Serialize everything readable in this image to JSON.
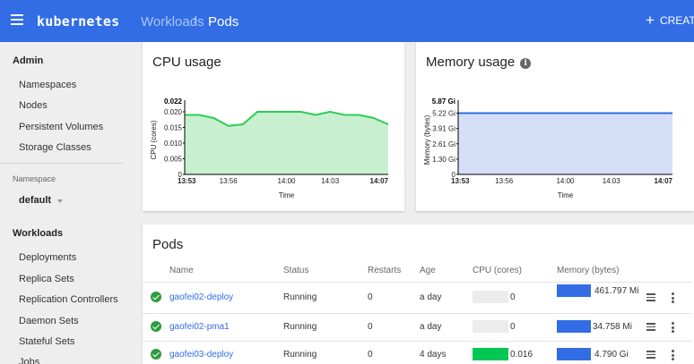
{
  "topbar": {
    "brand": "kubernetes",
    "breadcrumb": [
      "Workloads",
      "Pods"
    ],
    "breadcrumb_sep": "›",
    "create_label": "CREATE",
    "color": "#326de6"
  },
  "sidebar": {
    "admin_title": "Admin",
    "admin_items": [
      "Namespaces",
      "Nodes",
      "Persistent Volumes",
      "Storage Classes"
    ],
    "namespace_label": "Namespace",
    "namespace_value": "default",
    "workloads_title": "Workloads",
    "workload_items": [
      "Deployments",
      "Replica Sets",
      "Replication Controllers",
      "Daemon Sets",
      "Stateful Sets",
      "Jobs"
    ]
  },
  "cpu_card": {
    "title": "CPU usage"
  },
  "memory_card": {
    "title": "Memory usage",
    "info_icon": "i"
  },
  "pods_card": {
    "title": "Pods",
    "columns": [
      "Name",
      "Status",
      "Restarts",
      "Age",
      "CPU (cores)",
      "Memory (bytes)"
    ],
    "rows": [
      {
        "name": "gaofei02-deploy",
        "status": "Running",
        "restarts": "0",
        "age": "a day",
        "cpu": "0",
        "cpu_fraction": 0.0,
        "memory": "461.797 Mi",
        "memory_fraction": 0.95
      },
      {
        "name": "gaofei02-pma1",
        "status": "Running",
        "restarts": "0",
        "age": "a day",
        "cpu": "0",
        "cpu_fraction": 0.0,
        "memory": "34.758 Mi",
        "memory_fraction": 0.95
      },
      {
        "name": "gaofei03-deploy",
        "status": "Running",
        "restarts": "0",
        "age": "4 days",
        "cpu": "0.016",
        "cpu_fraction": 0.6,
        "memory": "4.790 Gi",
        "memory_fraction": 0.95
      }
    ]
  },
  "chart_data": [
    {
      "type": "area",
      "ylabel": "CPU (cores)",
      "xlabel": "Time",
      "x_ticks": [
        "13:53",
        "13:56",
        "14:00",
        "14:03",
        "14:07"
      ],
      "y_ticks": [
        "0",
        "0.005",
        "0.010",
        "0.015",
        "0.020"
      ],
      "y_max_label": "0.022",
      "ylim": [
        0,
        0.022
      ],
      "x_minutes": [
        0,
        1,
        2,
        3,
        4,
        5,
        6,
        7,
        8,
        9,
        10,
        11,
        12,
        13,
        14
      ],
      "series": [
        {
          "values": [
            0.019,
            0.019,
            0.018,
            0.0155,
            0.016,
            0.02,
            0.02,
            0.02,
            0.02,
            0.019,
            0.02,
            0.019,
            0.019,
            0.018,
            0.016
          ]
        }
      ],
      "color": "#2ecc57",
      "fill": "#c8f0d0"
    },
    {
      "type": "area",
      "ylabel": "Memory (bytes)",
      "xlabel": "Time",
      "x_ticks": [
        "13:53",
        "13:56",
        "14:00",
        "14:03",
        "14:07"
      ],
      "y_ticks": [
        "0",
        "1.30 Gi",
        "2.61 Gi",
        "3.91 Gi",
        "5.22 Gi"
      ],
      "y_max_label": "5.87 Gi",
      "ylim": [
        0,
        5.87
      ],
      "x_minutes": [
        0,
        14
      ],
      "series": [
        {
          "values": [
            5.22,
            5.22
          ]
        }
      ],
      "color": "#326de6",
      "fill": "#d5dff8"
    }
  ]
}
